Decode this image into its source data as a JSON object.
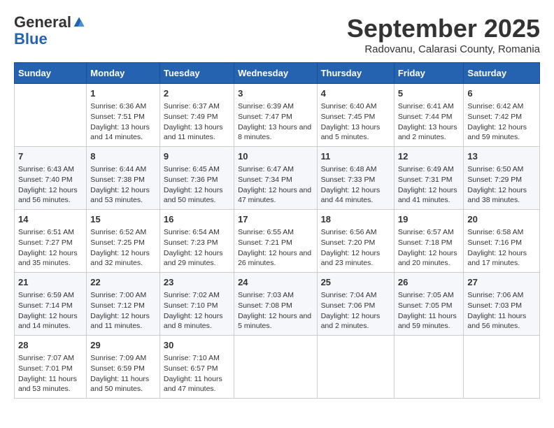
{
  "header": {
    "logo_general": "General",
    "logo_blue": "Blue",
    "month": "September 2025",
    "location": "Radovanu, Calarasi County, Romania"
  },
  "weekdays": [
    "Sunday",
    "Monday",
    "Tuesday",
    "Wednesday",
    "Thursday",
    "Friday",
    "Saturday"
  ],
  "weeks": [
    [
      {
        "day": "",
        "sunrise": "",
        "sunset": "",
        "daylight": ""
      },
      {
        "day": "1",
        "sunrise": "Sunrise: 6:36 AM",
        "sunset": "Sunset: 7:51 PM",
        "daylight": "Daylight: 13 hours and 14 minutes."
      },
      {
        "day": "2",
        "sunrise": "Sunrise: 6:37 AM",
        "sunset": "Sunset: 7:49 PM",
        "daylight": "Daylight: 13 hours and 11 minutes."
      },
      {
        "day": "3",
        "sunrise": "Sunrise: 6:39 AM",
        "sunset": "Sunset: 7:47 PM",
        "daylight": "Daylight: 13 hours and 8 minutes."
      },
      {
        "day": "4",
        "sunrise": "Sunrise: 6:40 AM",
        "sunset": "Sunset: 7:45 PM",
        "daylight": "Daylight: 13 hours and 5 minutes."
      },
      {
        "day": "5",
        "sunrise": "Sunrise: 6:41 AM",
        "sunset": "Sunset: 7:44 PM",
        "daylight": "Daylight: 13 hours and 2 minutes."
      },
      {
        "day": "6",
        "sunrise": "Sunrise: 6:42 AM",
        "sunset": "Sunset: 7:42 PM",
        "daylight": "Daylight: 12 hours and 59 minutes."
      }
    ],
    [
      {
        "day": "7",
        "sunrise": "Sunrise: 6:43 AM",
        "sunset": "Sunset: 7:40 PM",
        "daylight": "Daylight: 12 hours and 56 minutes."
      },
      {
        "day": "8",
        "sunrise": "Sunrise: 6:44 AM",
        "sunset": "Sunset: 7:38 PM",
        "daylight": "Daylight: 12 hours and 53 minutes."
      },
      {
        "day": "9",
        "sunrise": "Sunrise: 6:45 AM",
        "sunset": "Sunset: 7:36 PM",
        "daylight": "Daylight: 12 hours and 50 minutes."
      },
      {
        "day": "10",
        "sunrise": "Sunrise: 6:47 AM",
        "sunset": "Sunset: 7:34 PM",
        "daylight": "Daylight: 12 hours and 47 minutes."
      },
      {
        "day": "11",
        "sunrise": "Sunrise: 6:48 AM",
        "sunset": "Sunset: 7:33 PM",
        "daylight": "Daylight: 12 hours and 44 minutes."
      },
      {
        "day": "12",
        "sunrise": "Sunrise: 6:49 AM",
        "sunset": "Sunset: 7:31 PM",
        "daylight": "Daylight: 12 hours and 41 minutes."
      },
      {
        "day": "13",
        "sunrise": "Sunrise: 6:50 AM",
        "sunset": "Sunset: 7:29 PM",
        "daylight": "Daylight: 12 hours and 38 minutes."
      }
    ],
    [
      {
        "day": "14",
        "sunrise": "Sunrise: 6:51 AM",
        "sunset": "Sunset: 7:27 PM",
        "daylight": "Daylight: 12 hours and 35 minutes."
      },
      {
        "day": "15",
        "sunrise": "Sunrise: 6:52 AM",
        "sunset": "Sunset: 7:25 PM",
        "daylight": "Daylight: 12 hours and 32 minutes."
      },
      {
        "day": "16",
        "sunrise": "Sunrise: 6:54 AM",
        "sunset": "Sunset: 7:23 PM",
        "daylight": "Daylight: 12 hours and 29 minutes."
      },
      {
        "day": "17",
        "sunrise": "Sunrise: 6:55 AM",
        "sunset": "Sunset: 7:21 PM",
        "daylight": "Daylight: 12 hours and 26 minutes."
      },
      {
        "day": "18",
        "sunrise": "Sunrise: 6:56 AM",
        "sunset": "Sunset: 7:20 PM",
        "daylight": "Daylight: 12 hours and 23 minutes."
      },
      {
        "day": "19",
        "sunrise": "Sunrise: 6:57 AM",
        "sunset": "Sunset: 7:18 PM",
        "daylight": "Daylight: 12 hours and 20 minutes."
      },
      {
        "day": "20",
        "sunrise": "Sunrise: 6:58 AM",
        "sunset": "Sunset: 7:16 PM",
        "daylight": "Daylight: 12 hours and 17 minutes."
      }
    ],
    [
      {
        "day": "21",
        "sunrise": "Sunrise: 6:59 AM",
        "sunset": "Sunset: 7:14 PM",
        "daylight": "Daylight: 12 hours and 14 minutes."
      },
      {
        "day": "22",
        "sunrise": "Sunrise: 7:00 AM",
        "sunset": "Sunset: 7:12 PM",
        "daylight": "Daylight: 12 hours and 11 minutes."
      },
      {
        "day": "23",
        "sunrise": "Sunrise: 7:02 AM",
        "sunset": "Sunset: 7:10 PM",
        "daylight": "Daylight: 12 hours and 8 minutes."
      },
      {
        "day": "24",
        "sunrise": "Sunrise: 7:03 AM",
        "sunset": "Sunset: 7:08 PM",
        "daylight": "Daylight: 12 hours and 5 minutes."
      },
      {
        "day": "25",
        "sunrise": "Sunrise: 7:04 AM",
        "sunset": "Sunset: 7:06 PM",
        "daylight": "Daylight: 12 hours and 2 minutes."
      },
      {
        "day": "26",
        "sunrise": "Sunrise: 7:05 AM",
        "sunset": "Sunset: 7:05 PM",
        "daylight": "Daylight: 11 hours and 59 minutes."
      },
      {
        "day": "27",
        "sunrise": "Sunrise: 7:06 AM",
        "sunset": "Sunset: 7:03 PM",
        "daylight": "Daylight: 11 hours and 56 minutes."
      }
    ],
    [
      {
        "day": "28",
        "sunrise": "Sunrise: 7:07 AM",
        "sunset": "Sunset: 7:01 PM",
        "daylight": "Daylight: 11 hours and 53 minutes."
      },
      {
        "day": "29",
        "sunrise": "Sunrise: 7:09 AM",
        "sunset": "Sunset: 6:59 PM",
        "daylight": "Daylight: 11 hours and 50 minutes."
      },
      {
        "day": "30",
        "sunrise": "Sunrise: 7:10 AM",
        "sunset": "Sunset: 6:57 PM",
        "daylight": "Daylight: 11 hours and 47 minutes."
      },
      {
        "day": "",
        "sunrise": "",
        "sunset": "",
        "daylight": ""
      },
      {
        "day": "",
        "sunrise": "",
        "sunset": "",
        "daylight": ""
      },
      {
        "day": "",
        "sunrise": "",
        "sunset": "",
        "daylight": ""
      },
      {
        "day": "",
        "sunrise": "",
        "sunset": "",
        "daylight": ""
      }
    ]
  ]
}
